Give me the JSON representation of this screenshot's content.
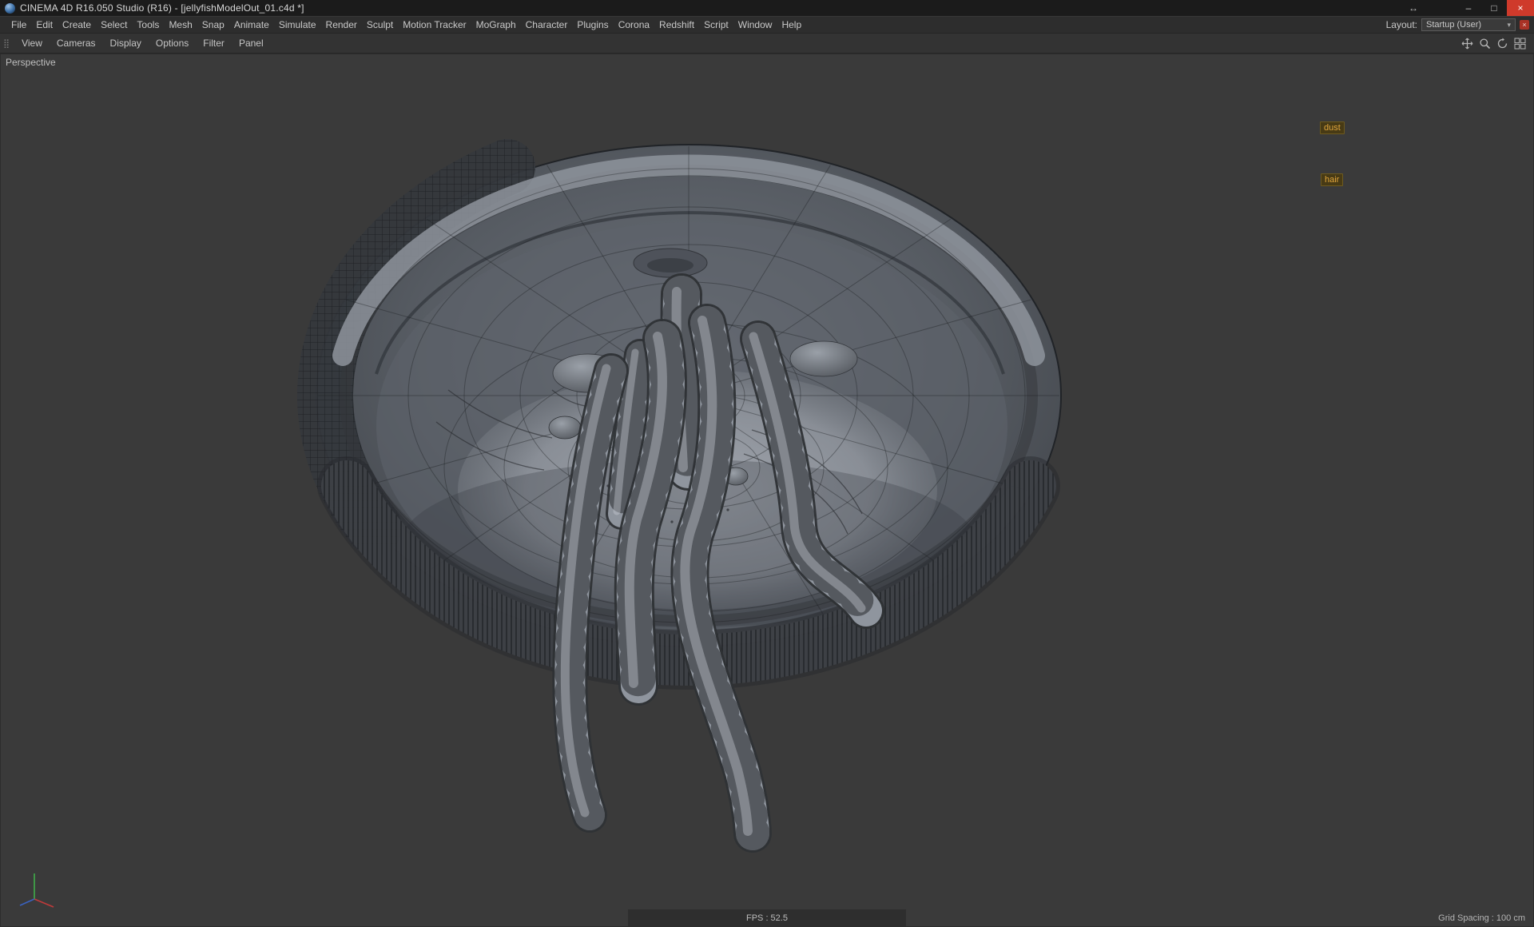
{
  "colors": {
    "tag-text": "#e0a53c",
    "axis-x": "#c03a3a",
    "axis-y": "#3fae4a",
    "axis-z": "#3a62c0",
    "close-button": "#cf3a2b"
  },
  "icons": {
    "minimize": "–",
    "maximize": "□",
    "close": "×",
    "pin": "↔",
    "caret": "▾",
    "grip": "⣿",
    "red_x": "×"
  },
  "window": {
    "title": "CINEMA 4D R16.050 Studio (R16) - [jellyfishModelOut_01.c4d *]"
  },
  "menu_bar": {
    "items": [
      "File",
      "Edit",
      "Create",
      "Select",
      "Tools",
      "Mesh",
      "Snap",
      "Animate",
      "Simulate",
      "Render",
      "Sculpt",
      "Motion Tracker",
      "MoGraph",
      "Character",
      "Plugins",
      "Corona",
      "Redshift",
      "Script",
      "Window",
      "Help"
    ],
    "layout_label": "Layout:",
    "layout_value": "Startup (User)"
  },
  "viewport_bar": {
    "items": [
      "View",
      "Cameras",
      "Display",
      "Options",
      "Filter",
      "Panel"
    ]
  },
  "viewport": {
    "label": "Perspective",
    "tags": [
      {
        "label": "dust"
      },
      {
        "label": "hair"
      }
    ],
    "fps": "FPS : 52.5",
    "grid_spacing": "Grid Spacing : 100 cm"
  }
}
